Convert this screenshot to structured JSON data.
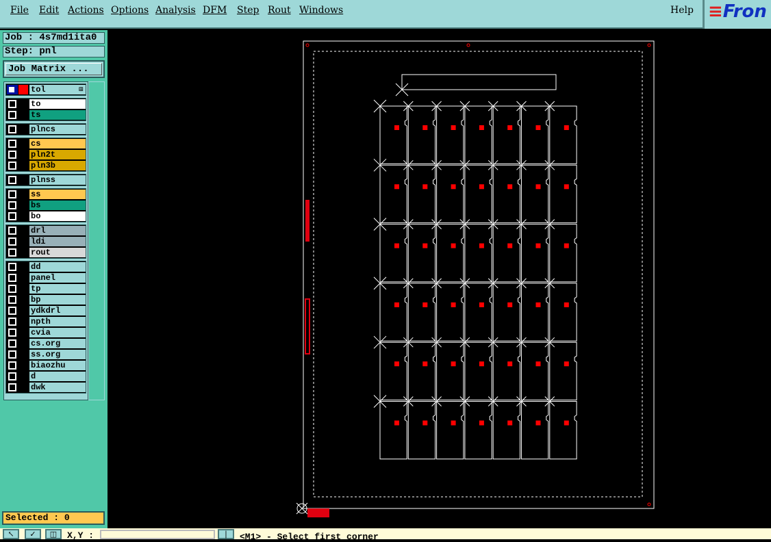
{
  "menu": [
    "File",
    "Edit",
    "Actions",
    "Options",
    "Analysis",
    "DFM",
    "Step",
    "Rout",
    "Windows"
  ],
  "help": "Help",
  "logo": "Fron",
  "job": "Job : 4s7md1ita0",
  "step": "Step: pnl",
  "job_matrix": "Job Matrix ...",
  "header_layer": "tol",
  "groups": [
    [
      {
        "n": "to",
        "c": "#ffffff"
      },
      {
        "n": "ts",
        "c": "#10a080"
      }
    ],
    [
      {
        "n": "plncs",
        "c": "#9ed8d8"
      }
    ],
    [
      {
        "n": "cs",
        "c": "#ffc850"
      },
      {
        "n": "pln2t",
        "c": "#d8a800"
      },
      {
        "n": "pln3b",
        "c": "#d8a800"
      }
    ],
    [
      {
        "n": "plnss",
        "c": "#9ed8d8"
      }
    ],
    [
      {
        "n": "ss",
        "c": "#ffc850"
      },
      {
        "n": "bs",
        "c": "#10a080"
      },
      {
        "n": "bo",
        "c": "#ffffff"
      }
    ],
    [
      {
        "n": "drl",
        "c": "#98b0b8"
      },
      {
        "n": "ldi",
        "c": "#98b0b8"
      },
      {
        "n": "rout",
        "c": "#d8d8d8"
      }
    ],
    [
      {
        "n": "dd",
        "c": "#9ed8d8"
      },
      {
        "n": "panel",
        "c": "#9ed8d8"
      },
      {
        "n": "tp",
        "c": "#9ed8d8"
      },
      {
        "n": "bp",
        "c": "#9ed8d8"
      },
      {
        "n": "ydkdrl",
        "c": "#9ed8d8"
      },
      {
        "n": "npth",
        "c": "#9ed8d8"
      },
      {
        "n": "cvia",
        "c": "#9ed8d8"
      },
      {
        "n": "cs.org",
        "c": "#9ed8d8"
      },
      {
        "n": "ss.org",
        "c": "#9ed8d8"
      },
      {
        "n": "biaozhu",
        "c": "#9ed8d8"
      },
      {
        "n": "d",
        "c": "#9ed8d8"
      },
      {
        "n": "dwk",
        "c": "#9ed8d8"
      }
    ]
  ],
  "selected": "Selected : 0",
  "xy_label": "X,Y :",
  "coord_value": "",
  "prompt": "<M1> - Select first corner"
}
